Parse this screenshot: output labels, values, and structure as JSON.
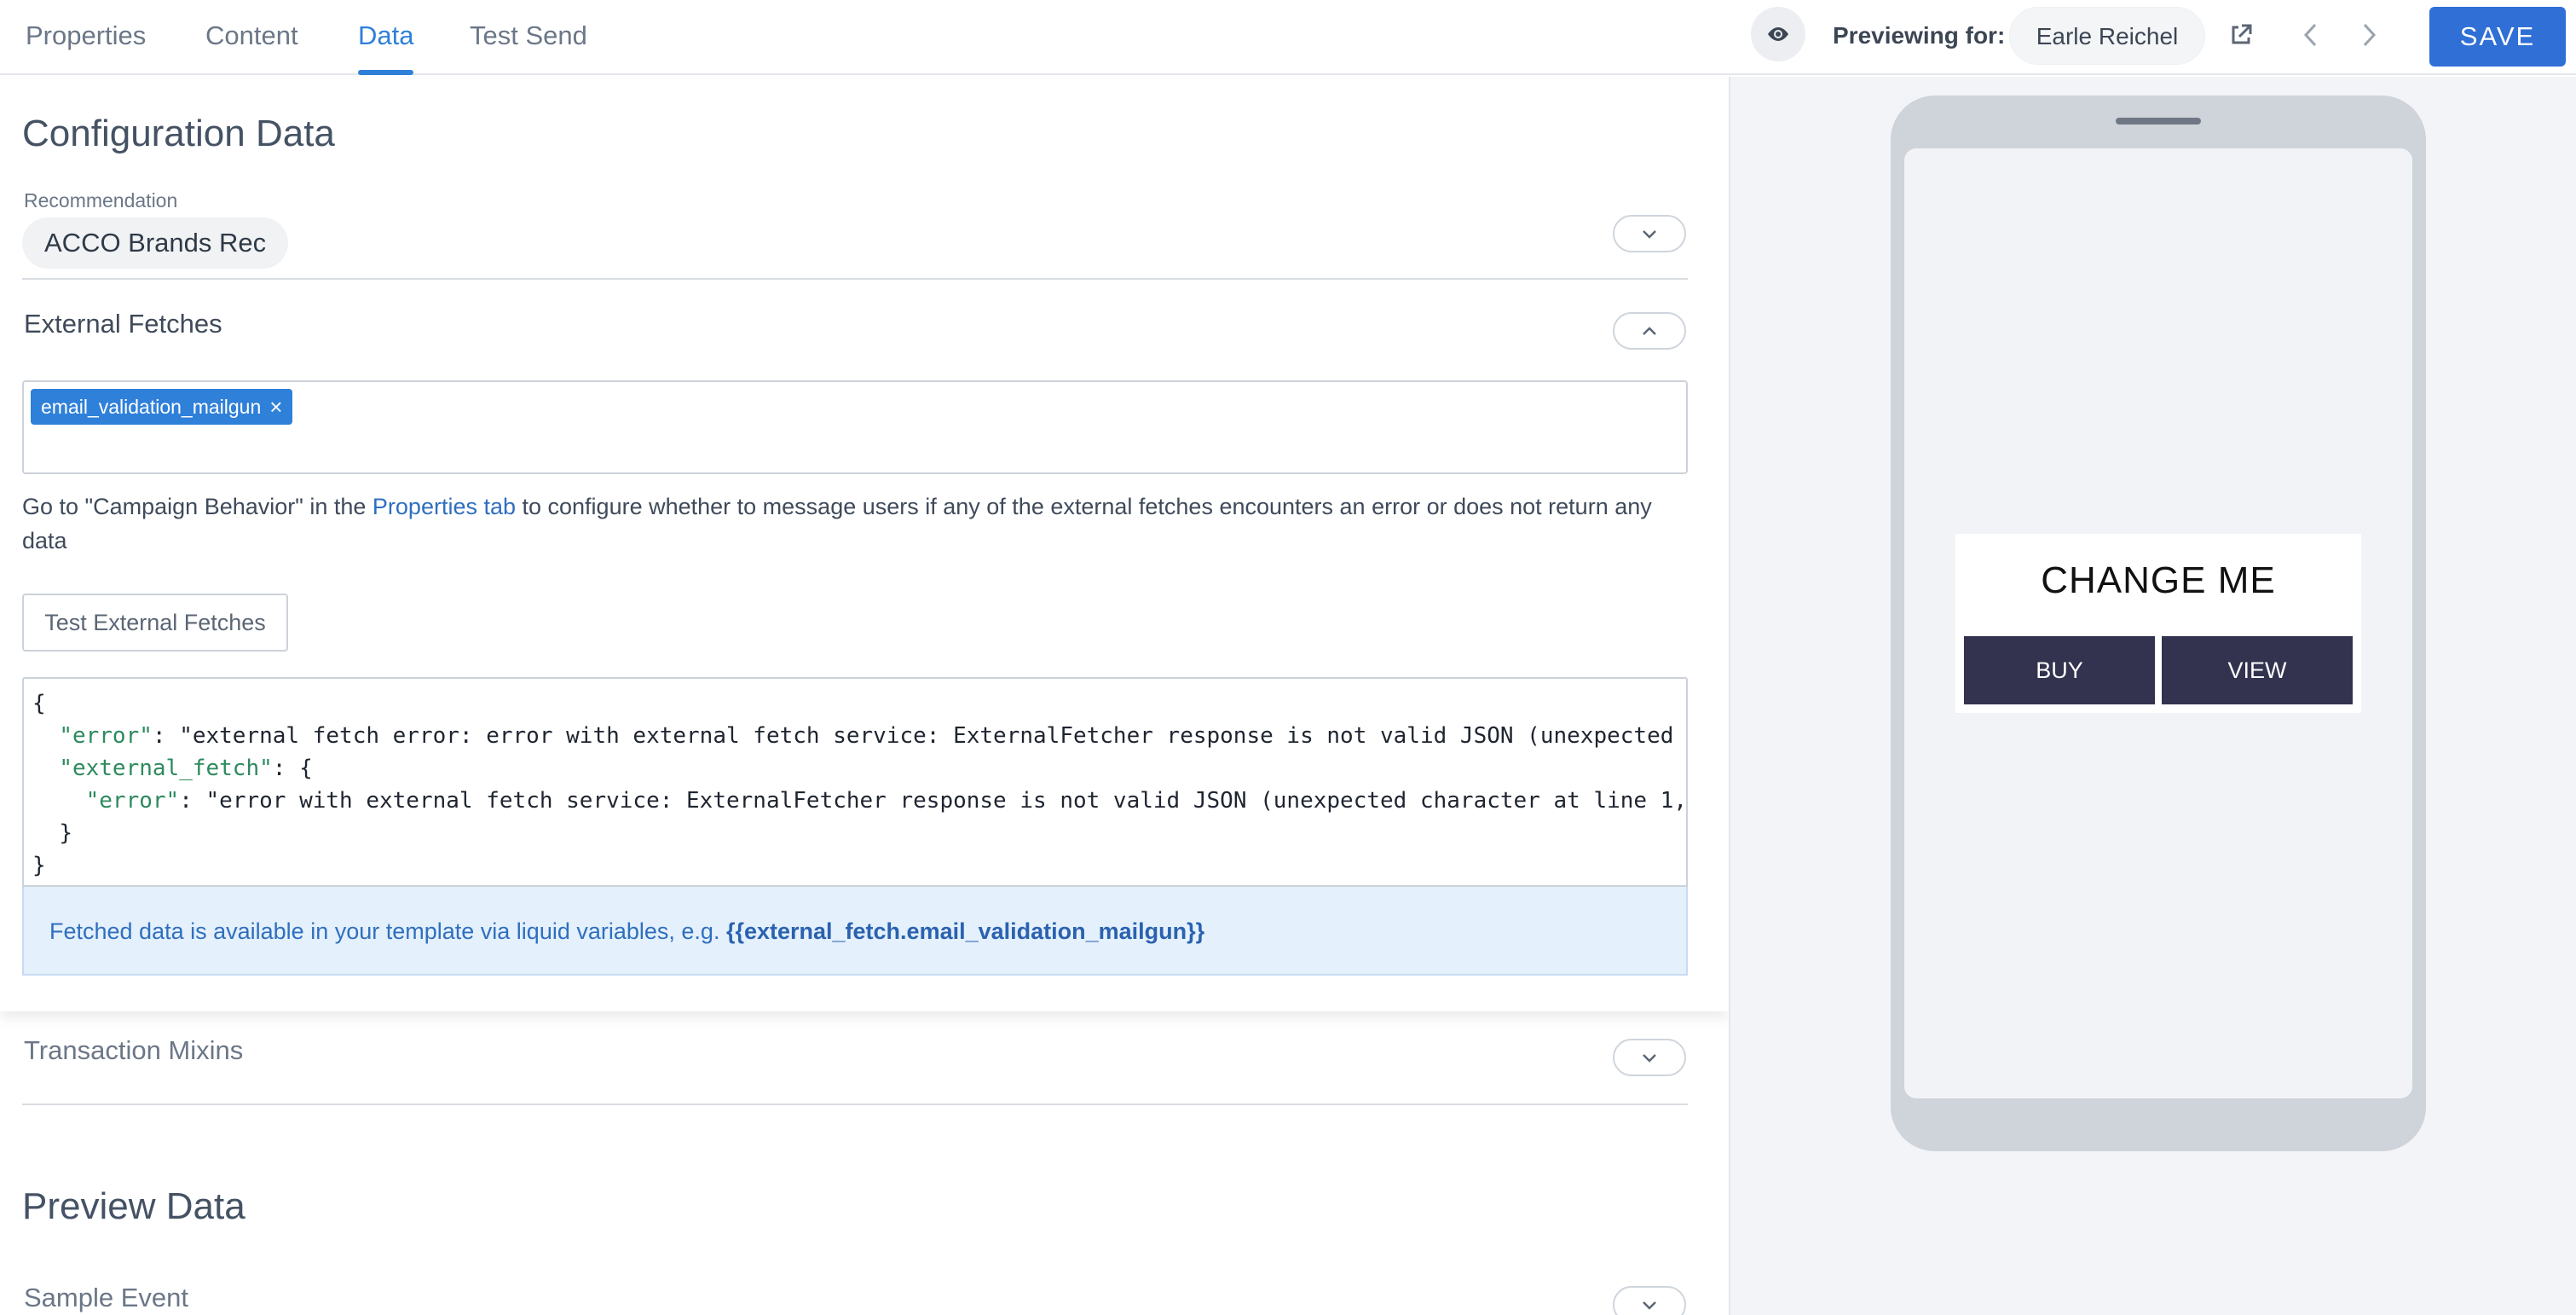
{
  "tabs": [
    {
      "label": "Properties"
    },
    {
      "label": "Content"
    },
    {
      "label": "Data",
      "active": true
    },
    {
      "label": "Test Send"
    }
  ],
  "header": {
    "previewing_label": "Previewing for:",
    "preview_user": "Earle Reichel",
    "save_label": "SAVE",
    "icons": [
      "eye-icon",
      "external-link-icon",
      "chevron-left-icon",
      "chevron-right-icon"
    ]
  },
  "config": {
    "title": "Configuration Data",
    "recommendation_label": "Recommendation",
    "recommendation_value": "ACCO Brands Rec"
  },
  "external_fetches": {
    "title": "External Fetches",
    "tags": [
      {
        "label": "email_validation_mailgun"
      }
    ],
    "help_prefix": "Go to \"Campaign Behavior\" in the ",
    "help_link": "Properties tab",
    "help_suffix": " to configure whether to message users if any of the external fetches encounters an error or does not return any data",
    "test_button": "Test External Fetches",
    "code_lines": [
      {
        "open": "{"
      },
      {
        "key": "\"error\"",
        "rest": ": \"external fetch error: error with external fetch service: ExternalFetcher response is not valid JSON (unexpected"
      },
      {
        "key": "\"external_fetch\"",
        "rest": ": {"
      },
      {
        "key": "\"error\"",
        "rest": ": \"error with external fetch service: ExternalFetcher response is not valid JSON (unexpected character at line 1,"
      },
      {
        "close": "}"
      },
      {
        "close_root": "}"
      }
    ],
    "info_prefix": "Fetched data is available in your template via liquid variables, e.g. ",
    "info_variable": "{{external_fetch.email_validation_mailgun}}"
  },
  "transaction_mixins": {
    "title": "Transaction Mixins"
  },
  "preview": {
    "title": "Preview Data",
    "sample_event_label": "Sample Event"
  },
  "phone_preview": {
    "message_title": "CHANGE ME",
    "buttons": [
      "BUY",
      "VIEW"
    ],
    "message_button_color": "#33334f"
  },
  "colors": {
    "accent": "#2f80d9",
    "save": "#2f6fd6",
    "info_bg": "#e4f0fb"
  }
}
